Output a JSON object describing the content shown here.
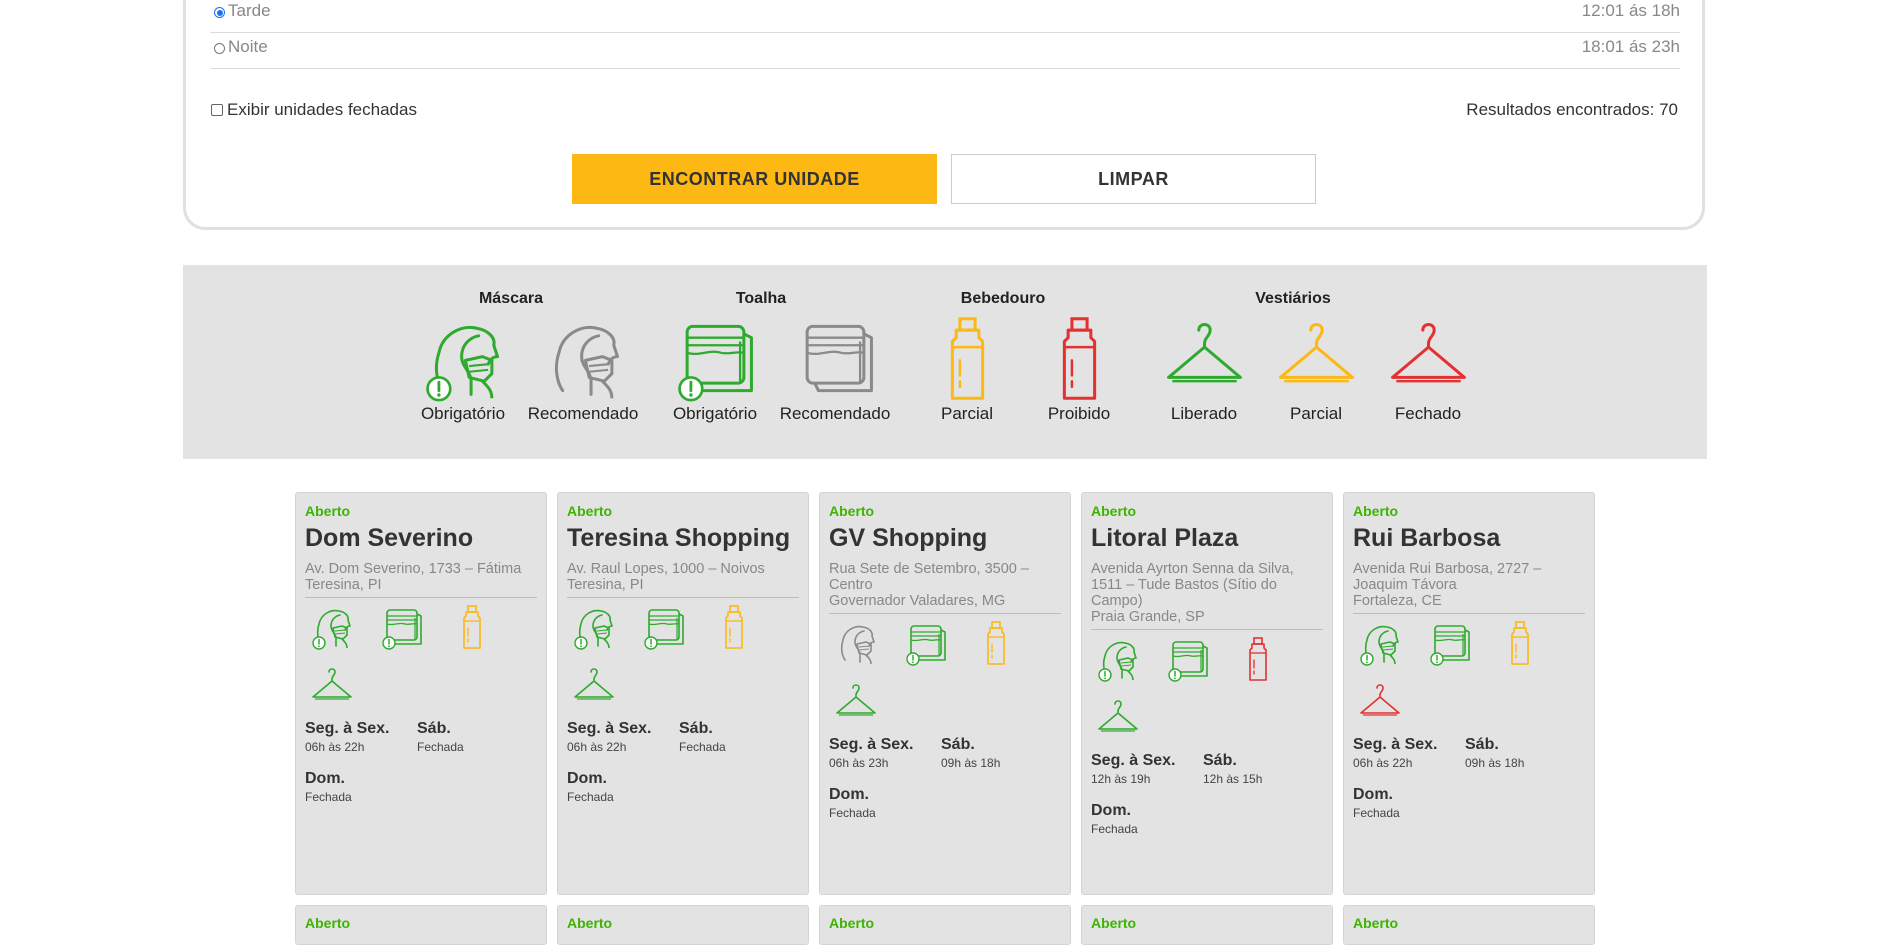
{
  "periods": [
    {
      "label": "Tarde",
      "hours": "12:01 ás 18h",
      "checked": true
    },
    {
      "label": "Noite",
      "hours": "18:01 ás 23h",
      "checked": false
    }
  ],
  "closed_units_label": "Exibir unidades fechadas",
  "results_label": "Resultados encontrados: 70",
  "buttons": {
    "find": "ENCONTRAR UNIDADE",
    "clear": "LIMPAR"
  },
  "legend": {
    "groups": [
      "Máscara",
      "Toalha",
      "Bebedouro",
      "Vestiários"
    ],
    "items": [
      {
        "icon": "mask-icon",
        "status": "Obrigatório",
        "color": "#2eaa2e"
      },
      {
        "icon": "mask-icon",
        "status": "Recomendado",
        "color": "#8a8a8a"
      },
      {
        "icon": "towel-icon",
        "status": "Obrigatório",
        "color": "#2eaa2e"
      },
      {
        "icon": "towel-icon",
        "status": "Recomendado",
        "color": "#8a8a8a"
      },
      {
        "icon": "water-bottle-icon",
        "status": "Parcial",
        "color": "#fdb813"
      },
      {
        "icon": "water-bottle-icon",
        "status": "Proibido",
        "color": "#e53030"
      },
      {
        "icon": "hanger-icon",
        "status": "Liberado",
        "color": "#2eaa2e"
      },
      {
        "icon": "hanger-icon",
        "status": "Parcial",
        "color": "#fdb813"
      },
      {
        "icon": "hanger-icon",
        "status": "Fechado",
        "color": "#e53030"
      }
    ]
  },
  "cards": [
    {
      "status": "Aberto",
      "name": "Dom Severino",
      "address": [
        "Av. Dom Severino, 1733 – Fátima",
        "Teresina, PI"
      ],
      "icons": [
        {
          "icon": "mask-icon",
          "color": "#2eaa2e"
        },
        {
          "icon": "towel-icon",
          "color": "#2eaa2e"
        },
        {
          "icon": "water-bottle-icon",
          "color": "#fdb813"
        },
        {
          "icon": "hanger-icon",
          "color": "#2eaa2e"
        }
      ],
      "hours": [
        {
          "day": "Seg. à Sex.",
          "time": "06h às 22h"
        },
        {
          "day": "Sáb.",
          "time": "Fechada"
        },
        {
          "day": "Dom.",
          "time": "Fechada"
        }
      ]
    },
    {
      "status": "Aberto",
      "name": "Teresina Shopping",
      "address": [
        "Av. Raul Lopes, 1000 – Noivos",
        "Teresina, PI"
      ],
      "icons": [
        {
          "icon": "mask-icon",
          "color": "#2eaa2e"
        },
        {
          "icon": "towel-icon",
          "color": "#2eaa2e"
        },
        {
          "icon": "water-bottle-icon",
          "color": "#fdb813"
        },
        {
          "icon": "hanger-icon",
          "color": "#2eaa2e"
        }
      ],
      "hours": [
        {
          "day": "Seg. à Sex.",
          "time": "06h às 22h"
        },
        {
          "day": "Sáb.",
          "time": "Fechada"
        },
        {
          "day": "Dom.",
          "time": "Fechada"
        }
      ]
    },
    {
      "status": "Aberto",
      "name": "GV Shopping",
      "address": [
        "Rua Sete de Setembro, 3500 –",
        "Centro",
        "Governador Valadares, MG"
      ],
      "icons": [
        {
          "icon": "mask-icon",
          "color": "#8a8a8a"
        },
        {
          "icon": "towel-icon",
          "color": "#2eaa2e"
        },
        {
          "icon": "water-bottle-icon",
          "color": "#fdb813"
        },
        {
          "icon": "hanger-icon",
          "color": "#2eaa2e"
        }
      ],
      "hours": [
        {
          "day": "Seg. à Sex.",
          "time": "06h às 23h"
        },
        {
          "day": "Sáb.",
          "time": "09h às 18h"
        },
        {
          "day": "Dom.",
          "time": "Fechada"
        }
      ]
    },
    {
      "status": "Aberto",
      "name": "Litoral Plaza",
      "address": [
        "Avenida Ayrton Senna da Silva,",
        "1511 – Tude Bastos (Sítio do",
        "Campo)",
        "Praia Grande, SP"
      ],
      "icons": [
        {
          "icon": "mask-icon",
          "color": "#2eaa2e"
        },
        {
          "icon": "towel-icon",
          "color": "#2eaa2e"
        },
        {
          "icon": "water-bottle-icon",
          "color": "#e53030"
        },
        {
          "icon": "hanger-icon",
          "color": "#2eaa2e"
        }
      ],
      "hours": [
        {
          "day": "Seg. à Sex.",
          "time": "12h às 19h"
        },
        {
          "day": "Sáb.",
          "time": "12h às 15h"
        },
        {
          "day": "Dom.",
          "time": "Fechada"
        }
      ]
    },
    {
      "status": "Aberto",
      "name": "Rui Barbosa",
      "address": [
        "Avenida Rui Barbosa, 2727 –",
        "Joaquim Távora",
        "Fortaleza, CE"
      ],
      "icons": [
        {
          "icon": "mask-icon",
          "color": "#2eaa2e"
        },
        {
          "icon": "towel-icon",
          "color": "#2eaa2e"
        },
        {
          "icon": "water-bottle-icon",
          "color": "#fdb813"
        },
        {
          "icon": "hanger-icon",
          "color": "#e53030"
        }
      ],
      "hours": [
        {
          "day": "Seg. à Sex.",
          "time": "06h às 22h"
        },
        {
          "day": "Sáb.",
          "time": "09h às 18h"
        },
        {
          "day": "Dom.",
          "time": "Fechada"
        }
      ]
    }
  ],
  "next_row_status": [
    "Aberto",
    "Aberto",
    "Aberto",
    "Aberto",
    "Aberto"
  ]
}
